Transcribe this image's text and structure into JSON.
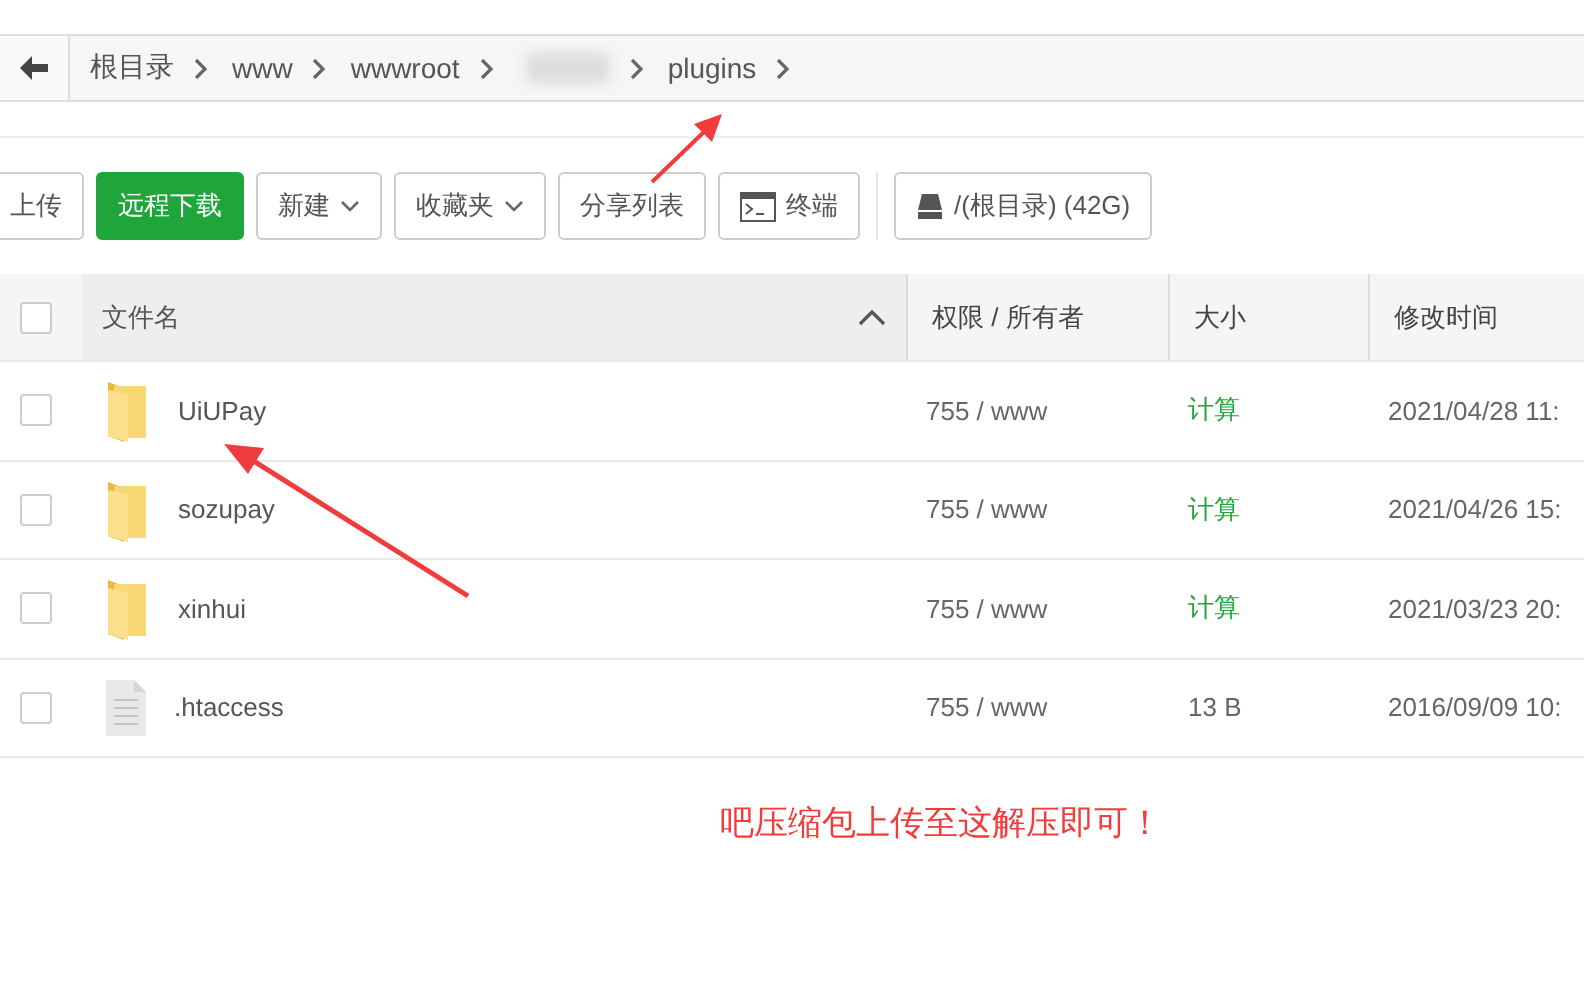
{
  "breadcrumb": {
    "items": [
      {
        "label": "根目录",
        "kind": "text"
      },
      {
        "label": "www",
        "kind": "text"
      },
      {
        "label": "wwwroot",
        "kind": "text"
      },
      {
        "kind": "blurred"
      },
      {
        "label": "plugins",
        "kind": "text"
      }
    ]
  },
  "toolbar": {
    "buttons": [
      {
        "label": "上传",
        "kind": "plain"
      },
      {
        "label": "远程下载",
        "kind": "primary"
      },
      {
        "label": "新建",
        "kind": "dropdown"
      },
      {
        "label": "收藏夹",
        "kind": "dropdown"
      },
      {
        "label": "分享列表",
        "kind": "plain"
      },
      {
        "label": "终端",
        "kind": "terminal"
      },
      {
        "label": "/(根目录) (42G)",
        "kind": "disk"
      }
    ]
  },
  "table": {
    "select_all_checked": false,
    "columns": [
      "文件名",
      "权限 / 所有者",
      "大小",
      "修改时间"
    ],
    "rows": [
      {
        "name": "UiUPay",
        "kind": "folder",
        "checked": false,
        "permission": "755 / www",
        "size": "计算",
        "size_is_action": true,
        "modified": "2021/04/28 11:"
      },
      {
        "name": "sozupay",
        "kind": "folder",
        "checked": false,
        "permission": "755 / www",
        "size": "计算",
        "size_is_action": true,
        "modified": "2021/04/26 15:"
      },
      {
        "name": "xinhui",
        "kind": "folder",
        "checked": false,
        "permission": "755 / www",
        "size": "计算",
        "size_is_action": true,
        "modified": "2021/03/23 20:"
      },
      {
        "name": ".htaccess",
        "kind": "file",
        "checked": false,
        "permission": "755 / www",
        "size": "13 B",
        "size_is_action": false,
        "modified": "2016/09/09 10:"
      }
    ]
  },
  "annotation": {
    "text": "吧压缩包上传至这解压即可！"
  }
}
